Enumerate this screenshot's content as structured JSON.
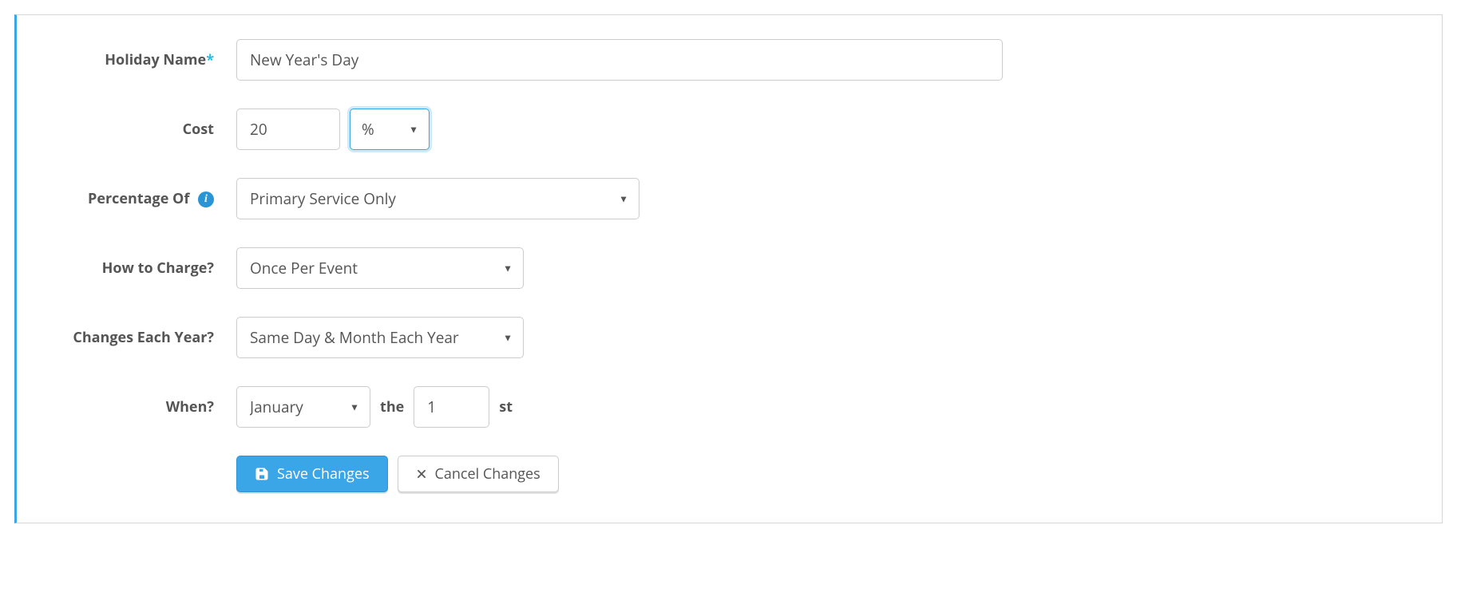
{
  "labels": {
    "holidayName": "Holiday Name",
    "required": "*",
    "cost": "Cost",
    "percentageOf": "Percentage Of",
    "howToCharge": "How to Charge?",
    "changesEachYear": "Changes Each Year?",
    "when": "When?",
    "the": "the",
    "ordinal": "st"
  },
  "values": {
    "holidayName": "New Year's Day",
    "cost": "20",
    "costUnit": "%",
    "percentageOf": "Primary Service Only",
    "howToCharge": "Once Per Event",
    "changesEachYear": "Same Day & Month Each Year",
    "month": "January",
    "day": "1"
  },
  "buttons": {
    "save": "Save Changes",
    "cancel": "Cancel Changes"
  },
  "icons": {
    "info": "i"
  }
}
